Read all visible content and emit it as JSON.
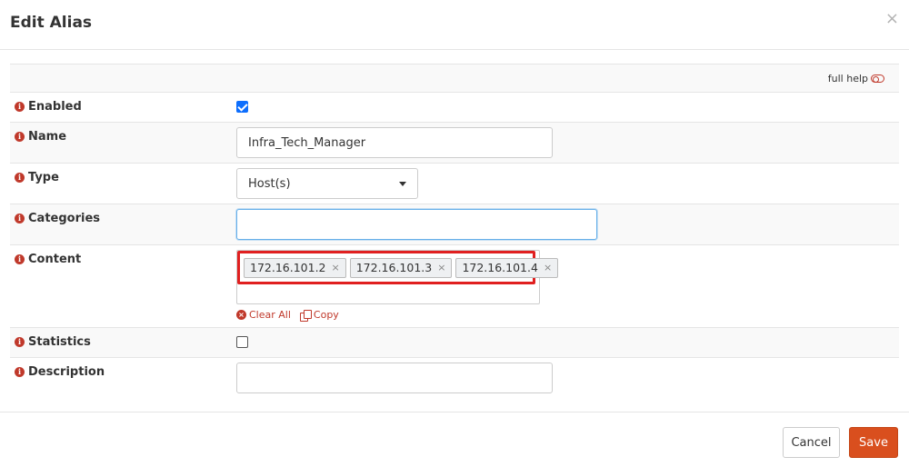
{
  "modal": {
    "title": "Edit Alias",
    "close_glyph": "×"
  },
  "help": {
    "label": "full help",
    "icon": "toggle-icon"
  },
  "fields": {
    "enabled": {
      "label": "Enabled",
      "checked": true
    },
    "name": {
      "label": "Name",
      "value": "Infra_Tech_Manager"
    },
    "type": {
      "label": "Type",
      "value": "Host(s)"
    },
    "categories": {
      "label": "Categories",
      "value": ""
    },
    "content": {
      "label": "Content",
      "tags": [
        "172.16.101.2",
        "172.16.101.3",
        "172.16.101.4"
      ],
      "tag_remove": "×",
      "clear_all": "Clear All",
      "copy": "Copy"
    },
    "statistics": {
      "label": "Statistics",
      "checked": false
    },
    "description": {
      "label": "Description",
      "value": ""
    }
  },
  "info_glyph": "i",
  "footer": {
    "cancel": "Cancel",
    "save": "Save"
  },
  "colors": {
    "accent": "#d94f1e",
    "info_icon": "#c0392b",
    "highlight": "#e02020",
    "checkbox": "#0d6efd"
  }
}
